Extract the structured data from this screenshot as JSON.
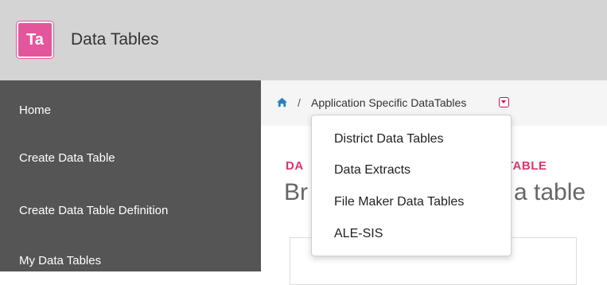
{
  "header": {
    "logo_text": "Ta",
    "logo_color": "#e4569b",
    "title": "Data Tables"
  },
  "sidebar": {
    "items": [
      {
        "label": "Home"
      },
      {
        "label": "Create Data Table"
      },
      {
        "label": "Create Data Table Definition"
      },
      {
        "label": "My Data Tables"
      }
    ]
  },
  "breadcrumb": {
    "home_icon": "home-icon",
    "separator": "/",
    "current": "Application Specific DataTables",
    "dropdown_icon": "caret-down-icon"
  },
  "content": {
    "label_left": "DA",
    "label_right": "TABLE",
    "heading_left": "Br",
    "heading_right": "a table"
  },
  "dropdown": {
    "items": [
      {
        "label": "District Data Tables"
      },
      {
        "label": "Data Extracts"
      },
      {
        "label": "File Maker Data Tables"
      },
      {
        "label": "ALE-SIS"
      }
    ]
  },
  "colors": {
    "accent": "#e0336f",
    "sidebar_bg": "#555555",
    "header_bg": "#d4d4d4"
  }
}
